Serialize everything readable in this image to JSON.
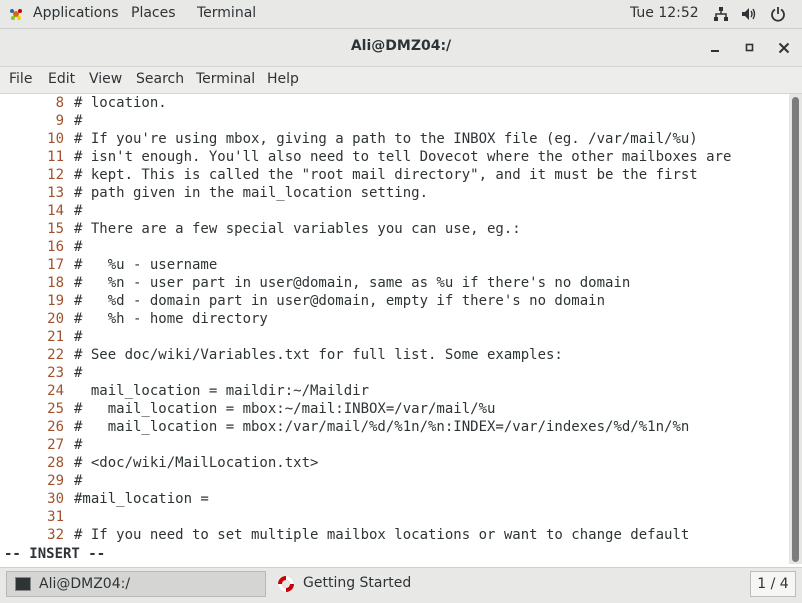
{
  "topbar": {
    "applications": "Applications",
    "places": "Places",
    "terminal": "Terminal",
    "clock": "Tue 12:52",
    "tray_icons": [
      "network-icon",
      "volume-icon",
      "power-icon"
    ]
  },
  "window": {
    "title": "Ali@DMZ04:/",
    "controls": [
      "minimize",
      "maximize",
      "close"
    ]
  },
  "menubar": {
    "items": [
      "File",
      "Edit",
      "View",
      "Search",
      "Terminal",
      "Help"
    ]
  },
  "editor": {
    "lines": [
      {
        "n": "8",
        "text": "# location."
      },
      {
        "n": "9",
        "text": "#"
      },
      {
        "n": "10",
        "text": "# If you're using mbox, giving a path to the INBOX file (eg. /var/mail/%u)"
      },
      {
        "n": "11",
        "text": "# isn't enough. You'll also need to tell Dovecot where the other mailboxes are"
      },
      {
        "n": "12",
        "text": "# kept. This is called the \"root mail directory\", and it must be the first"
      },
      {
        "n": "13",
        "text": "# path given in the mail_location setting."
      },
      {
        "n": "14",
        "text": "#"
      },
      {
        "n": "15",
        "text": "# There are a few special variables you can use, eg.:"
      },
      {
        "n": "16",
        "text": "#"
      },
      {
        "n": "17",
        "text": "#   %u - username"
      },
      {
        "n": "18",
        "text": "#   %n - user part in user@domain, same as %u if there's no domain"
      },
      {
        "n": "19",
        "text": "#   %d - domain part in user@domain, empty if there's no domain"
      },
      {
        "n": "20",
        "text": "#   %h - home directory"
      },
      {
        "n": "21",
        "text": "#"
      },
      {
        "n": "22",
        "text": "# See doc/wiki/Variables.txt for full list. Some examples:"
      },
      {
        "n": "23",
        "text": "#"
      },
      {
        "n": "24",
        "text": "  mail_location = maildir:~/Maildir"
      },
      {
        "n": "25",
        "text": "#   mail_location = mbox:~/mail:INBOX=/var/mail/%u"
      },
      {
        "n": "26",
        "text": "#   mail_location = mbox:/var/mail/%d/%1n/%n:INDEX=/var/indexes/%d/%1n/%n"
      },
      {
        "n": "27",
        "text": "#"
      },
      {
        "n": "28",
        "text": "# <doc/wiki/MailLocation.txt>"
      },
      {
        "n": "29",
        "text": "#"
      },
      {
        "n": "30",
        "text": "#mail_location ="
      },
      {
        "n": "31",
        "text": ""
      },
      {
        "n": "32",
        "text": "# If you need to set multiple mailbox locations or want to change default"
      }
    ],
    "status": "-- INSERT --"
  },
  "taskbar": {
    "task1": "Ali@DMZ04:/",
    "task2": "Getting Started",
    "workspace": "1 / 4"
  },
  "colors": {
    "line_number": "#a0522d",
    "text": "#2e3436",
    "chrome": "#e8e8e7"
  }
}
